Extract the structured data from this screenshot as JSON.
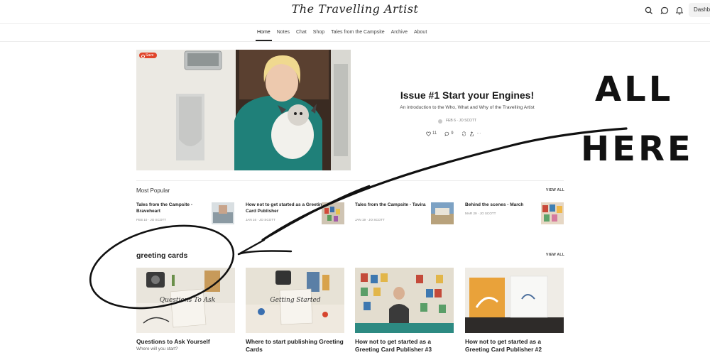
{
  "header": {
    "logo": "The Travelling Artist",
    "dashboard_label": "Dashb",
    "icons": [
      "search-icon",
      "chat-bubble-icon",
      "bell-icon"
    ]
  },
  "nav": {
    "items": [
      "Home",
      "Notes",
      "Chat",
      "Shop",
      "Tales from the Campsite",
      "Archive",
      "About"
    ],
    "active": "Home"
  },
  "hero": {
    "badge": "Save",
    "title": "Issue #1 Start your Engines!",
    "subtitle": "An introduction to the Who, What and Why of the Travelling Artist",
    "byline": "FEB 6 · JO SCOTT",
    "likes": "11",
    "comments": "9",
    "more": "···"
  },
  "most_popular": {
    "title": "Most Popular",
    "view_all": "VIEW ALL",
    "items": [
      {
        "title": "Tales from the Campsite - Braveheart",
        "meta": "FEB 10 · JO SCOTT"
      },
      {
        "title": "How not to get started as a Greeting Card Publisher",
        "meta": "JAN 16 · JO SCOTT"
      },
      {
        "title": "Tales from the Campsite - Tavira",
        "meta": "JAN 19 · JO SCOTT"
      },
      {
        "title": "Behind the scenes - March",
        "meta": "MAR 29 · JO SCOTT"
      }
    ]
  },
  "greeting_cards": {
    "title": "greeting cards",
    "view_all": "VIEW ALL",
    "cards": [
      {
        "title": "Questions to Ask Yourself",
        "subtitle": "Where will you start?",
        "image_text": "Questions To Ask"
      },
      {
        "title": "Where to start publishing Greeting Cards",
        "subtitle": "",
        "image_text": "Getting Started"
      },
      {
        "title": "How not to get started as a Greeting Card Publisher #3",
        "subtitle": ""
      },
      {
        "title": "How not to get started as a Greeting Card Publisher #2",
        "subtitle": ""
      }
    ]
  },
  "annotation": {
    "line1": "ALL",
    "line2": "HERE"
  }
}
